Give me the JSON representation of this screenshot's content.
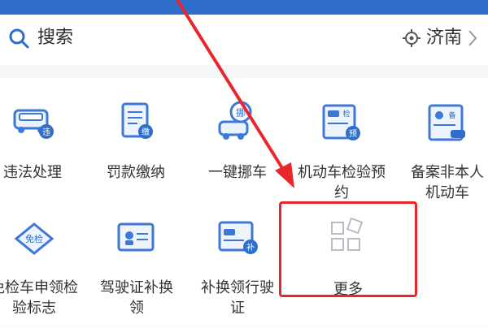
{
  "search": {
    "label": "搜索",
    "icon": "search-icon"
  },
  "location": {
    "city": "济南",
    "icon": "locate-icon"
  },
  "services": [
    {
      "label": "违法处理",
      "icon": "car-violation-icon"
    },
    {
      "label": "罚款缴纳",
      "icon": "fine-payment-icon"
    },
    {
      "label": "一键挪车",
      "icon": "move-car-icon"
    },
    {
      "label": "机动车检验预约",
      "icon": "inspection-appointment-icon"
    },
    {
      "label": "备案非本人机动车",
      "icon": "register-vehicle-icon"
    },
    {
      "label": "免检车申领检验标志",
      "icon": "exempt-car-icon"
    },
    {
      "label": "驾驶证补换领",
      "icon": "license-reissue-icon"
    },
    {
      "label": "补换领行驶证",
      "icon": "vehicle-license-icon"
    },
    {
      "label": "更多",
      "icon": "more-grid-icon"
    }
  ],
  "colors": {
    "primary": "#2f6fcb",
    "accent": "#3d78d6",
    "highlight": "#e8272d"
  }
}
